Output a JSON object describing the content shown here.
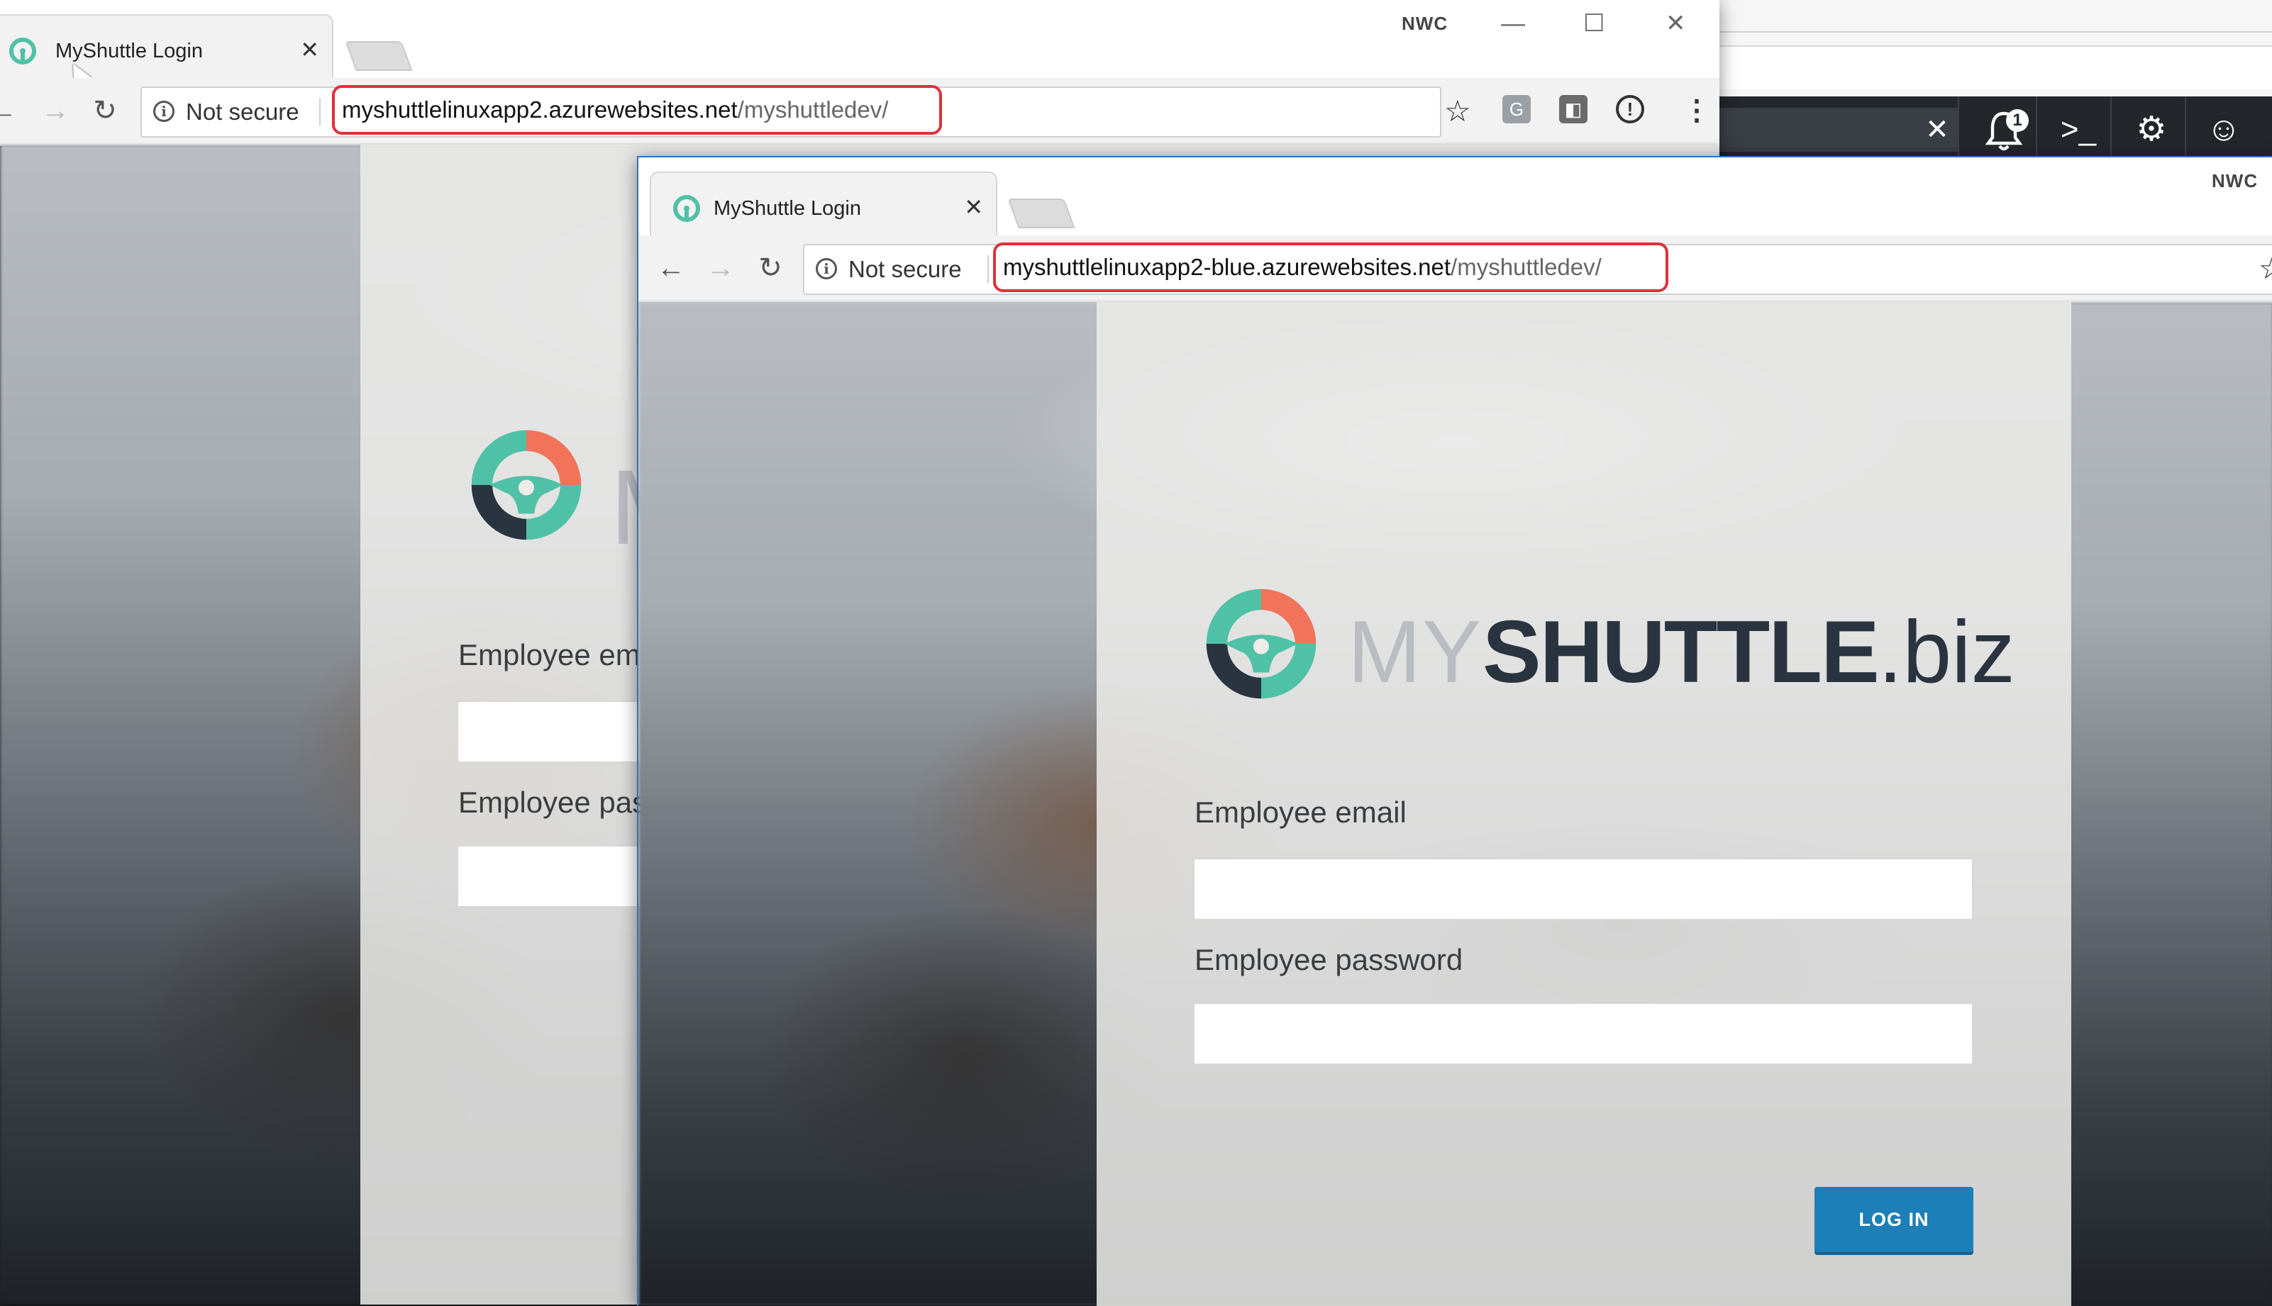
{
  "portal": {
    "notification_count": "1",
    "icons": [
      "close-icon",
      "bell-icon",
      "cloud-shell-icon",
      "gear-icon",
      "smiley-icon"
    ]
  },
  "back_window": {
    "tab_title": "MyShuttle Login",
    "security_label": "Not secure",
    "url_host": "myshuttlelinuxapp2.azurewebsites.net",
    "url_path": "/myshuttledev/",
    "badge": "NWC",
    "email_label": "Employee em",
    "password_label": "Employee pas"
  },
  "front_window": {
    "tab_title": "MyShuttle Login",
    "security_label": "Not secure",
    "url_host": "myshuttlelinuxapp2-blue.azurewebsites.net",
    "url_path": "/myshuttledev/",
    "badge": "NWC"
  },
  "login": {
    "logo_my": "MY",
    "logo_shuttle": "SHUTTLE",
    "logo_biz": ".biz",
    "email_label": "Employee email",
    "password_label": "Employee password",
    "login_button": "LOG IN"
  },
  "colors": {
    "url_highlight": "#e0303a",
    "login_button": "#1d7fb8",
    "logo_teal": "#4fc1a6",
    "logo_coral": "#f0735a",
    "logo_dark": "#2a3440"
  }
}
